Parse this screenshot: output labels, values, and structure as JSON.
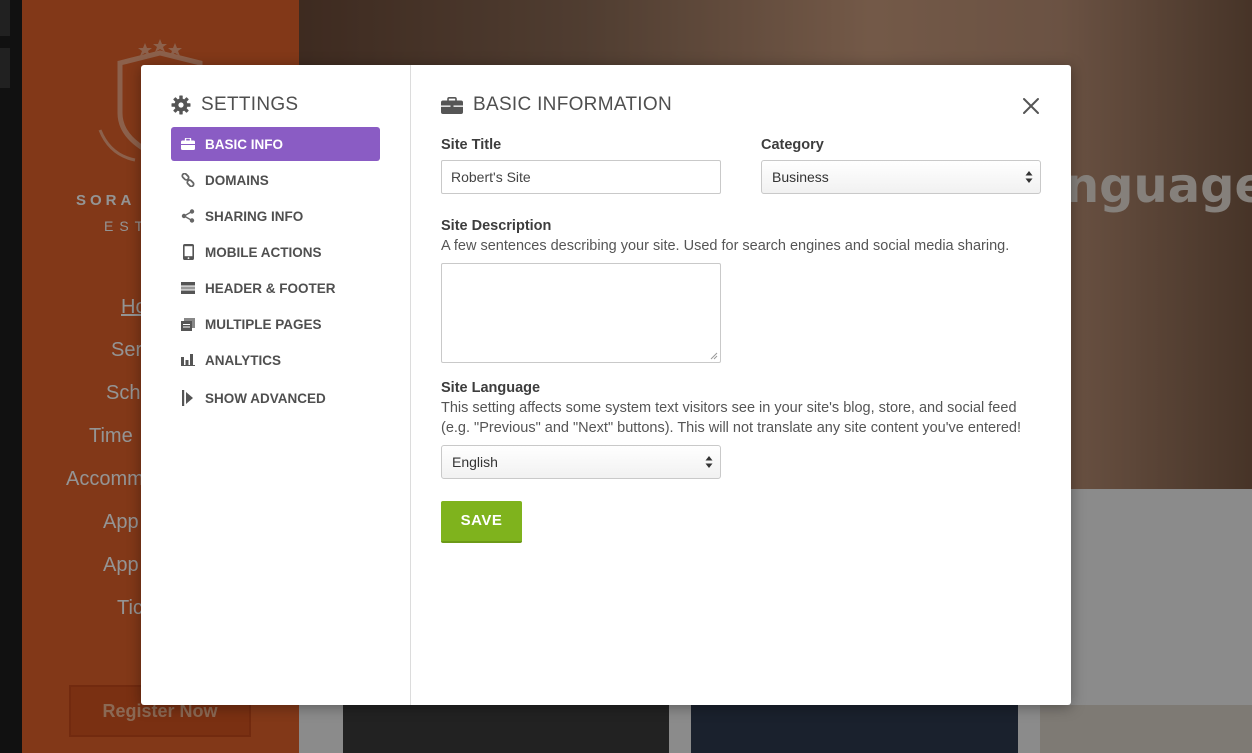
{
  "background": {
    "brand_name": "SORA E",
    "brand_sub": "EST",
    "nav_items": [
      "Ho",
      "Ser",
      "Sch",
      "Time",
      "Accomm",
      "App",
      "App",
      "Tic"
    ],
    "register_label": "Register Now",
    "hero_text": "nguage",
    "colors": {
      "sidebar": "#e0612a"
    }
  },
  "modal": {
    "sidebar": {
      "title": "SETTINGS",
      "title_icon": "gear-icon",
      "items": [
        {
          "label": "BASIC INFO",
          "icon": "briefcase-icon",
          "active": true
        },
        {
          "label": "DOMAINS",
          "icon": "link-icon",
          "active": false
        },
        {
          "label": "SHARING INFO",
          "icon": "share-icon",
          "active": false
        },
        {
          "label": "MOBILE ACTIONS",
          "icon": "mobile-icon",
          "active": false
        },
        {
          "label": "HEADER & FOOTER",
          "icon": "header-footer-icon",
          "active": false
        },
        {
          "label": "MULTIPLE PAGES",
          "icon": "pages-icon",
          "active": false
        },
        {
          "label": "ANALYTICS",
          "icon": "bar-chart-icon",
          "active": false
        }
      ],
      "advanced_label": "SHOW ADVANCED",
      "advanced_icon": "advanced-arrow-icon",
      "active_color": "#8a5cc4"
    },
    "content": {
      "title": "BASIC INFORMATION",
      "title_icon": "briefcase-icon",
      "close_icon": "close-icon",
      "site_title": {
        "label": "Site Title",
        "value": "Robert's Site"
      },
      "category": {
        "label": "Category",
        "value": "Business"
      },
      "site_description": {
        "label": "Site Description",
        "help": "A few sentences describing your site. Used for search engines and social media sharing.",
        "value": ""
      },
      "site_language": {
        "label": "Site Language",
        "help_line1": "This setting affects some system text visitors see in your site's blog, store, and social feed",
        "help_line2": "(e.g. \"Previous\" and \"Next\" buttons). This will not translate any site content you've entered!",
        "value": "English"
      },
      "save_label": "SAVE",
      "save_color": "#7fb31d"
    }
  }
}
